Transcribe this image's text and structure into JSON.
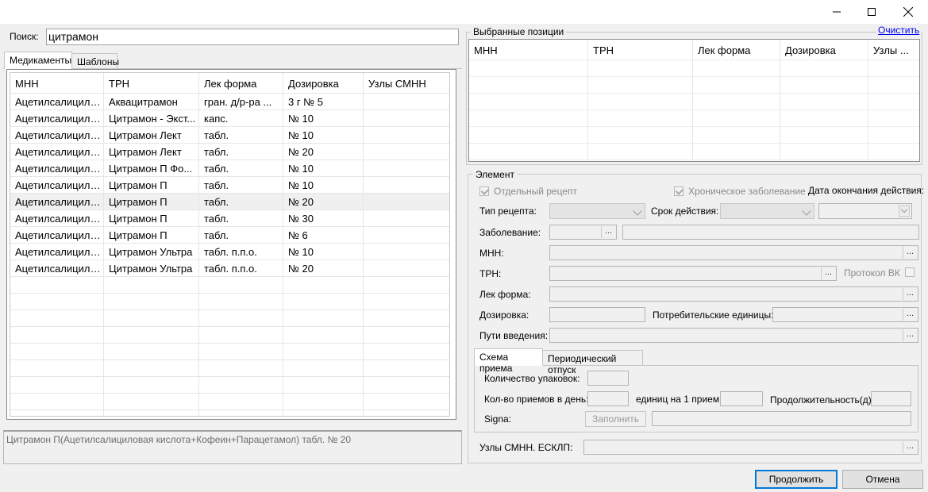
{
  "window": {
    "controls": [
      "minimize",
      "maximize",
      "close"
    ]
  },
  "search": {
    "label": "Поиск:",
    "value": "цитрамон"
  },
  "tabs": [
    {
      "label": "Медикаменты"
    },
    {
      "label": "Шаблоны"
    }
  ],
  "grid": {
    "columns": [
      "МНН",
      "ТРН",
      "Лек форма",
      "Дозировка",
      "Узлы СМНН"
    ],
    "rows": [
      [
        "Ацетилсалицило...",
        "Аквацитрамон",
        "гран. д/р-ра ...",
        "3 г № 5",
        ""
      ],
      [
        "Ацетилсалицило...",
        "Цитрамон - Экст...",
        "капс.",
        "№ 10",
        ""
      ],
      [
        "Ацетилсалицило...",
        "Цитрамон Лект",
        "табл.",
        "№ 10",
        ""
      ],
      [
        "Ацетилсалицило...",
        "Цитрамон Лект",
        "табл.",
        "№ 20",
        ""
      ],
      [
        "Ацетилсалицило...",
        "Цитрамон П Фо...",
        "табл.",
        "№ 10",
        ""
      ],
      [
        "Ацетилсалицило...",
        "Цитрамон П",
        "табл.",
        "№ 10",
        ""
      ],
      [
        "Ацетилсалицило...",
        "Цитрамон П",
        "табл.",
        "№ 20",
        ""
      ],
      [
        "Ацетилсалицило...",
        "Цитрамон П",
        "табл.",
        "№ 30",
        ""
      ],
      [
        "Ацетилсалицило...",
        "Цитрамон П",
        "табл.",
        "№ 6",
        ""
      ],
      [
        "Ацетилсалицило...",
        "Цитрамон Ультра",
        "табл. п.п.о.",
        "№ 10",
        ""
      ],
      [
        "Ацетилсалицило...",
        "Цитрамон Ультра",
        "табл. п.п.о.",
        "№ 20",
        ""
      ]
    ],
    "selected_row": 6
  },
  "description": "Цитрамон П(Ацетилсалициловая кислота+Кофеин+Парацетамол) табл.  № 20",
  "selected_positions": {
    "title": "Выбранные позиции",
    "clear_link": "Очистить",
    "columns": [
      "МНН",
      "ТРН",
      "Лек форма",
      "Дозировка",
      "Узлы ..."
    ]
  },
  "element": {
    "title": "Элемент",
    "separate_recipe": "Отдельный рецепт",
    "chronic": "Хроническое заболевание",
    "end_date_label": "Дата окончания действия:",
    "recipe_type_label": "Тип рецепта:",
    "validity_label": "Срок действия:",
    "disease_label": "Заболевание:",
    "mnn_label": "МНН:",
    "trn_label": "ТРН:",
    "protocol_label": "Протокол ВК",
    "form_label": "Лек форма:",
    "dosage_label": "Дозировка:",
    "consumer_units_label": "Потребительские единицы:",
    "routes_label": "Пути введения:",
    "dots": "..."
  },
  "sub_tabs": [
    {
      "label": "Схема приема"
    },
    {
      "label": "Периодический отпуск"
    }
  ],
  "schema": {
    "packages_label": "Количество упаковок:",
    "per_day_label": "Кол-во приемов в день:",
    "units_per_dose_label": "единиц на 1 прием:",
    "duration_label": "Продолжительность(д):",
    "signa_label": "Signa:",
    "fill_button": "Заполнить"
  },
  "nodes_label": "Узлы СМНН. ЕСКЛП:",
  "footer": {
    "continue": "Продолжить",
    "cancel": "Отмена"
  }
}
